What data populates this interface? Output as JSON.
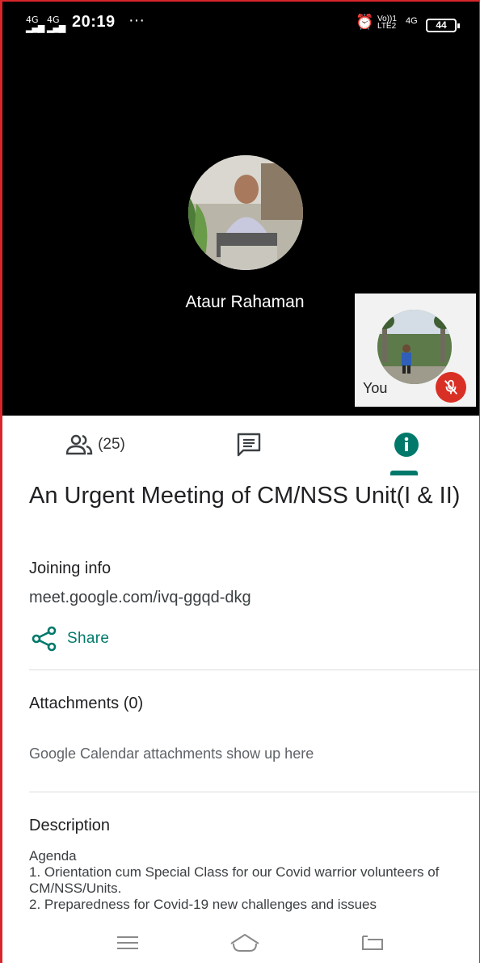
{
  "status": {
    "sim1": "4G",
    "sim2": "4G",
    "time": "20:19",
    "more": "···",
    "volte_top": "Vo))1",
    "volte_bottom": "LTE2",
    "net": "4G",
    "battery": "44"
  },
  "call": {
    "host_name": "Ataur Rahaman",
    "self_label": "You"
  },
  "tabs": {
    "people_count": "(25)"
  },
  "meeting": {
    "title": "An Urgent Meeting of CM/NSS Unit(I & II)",
    "joining_heading": "Joining info",
    "joining_link": "meet.google.com/ivq-ggqd-dkg",
    "share_label": "Share",
    "attachments_heading": "Attachments (0)",
    "attachments_note": "Google Calendar attachments show up here",
    "description_heading": "Description",
    "description_lines": [
      "Agenda",
      "1. Orientation cum Special Class for our Covid warrior volunteers of CM/NSS/Units.",
      "2. Preparedness for Covid-19 new challenges and issues"
    ]
  },
  "colors": {
    "accent": "#00796b",
    "mute_red": "#d93025",
    "video_bg": "#000000"
  },
  "icons": {
    "people": "people-icon",
    "chat": "chat-icon",
    "info": "info-icon",
    "share": "share-icon",
    "mic_off": "mic-off-icon",
    "menu": "menu-icon",
    "home": "home-icon",
    "back": "back-icon"
  }
}
